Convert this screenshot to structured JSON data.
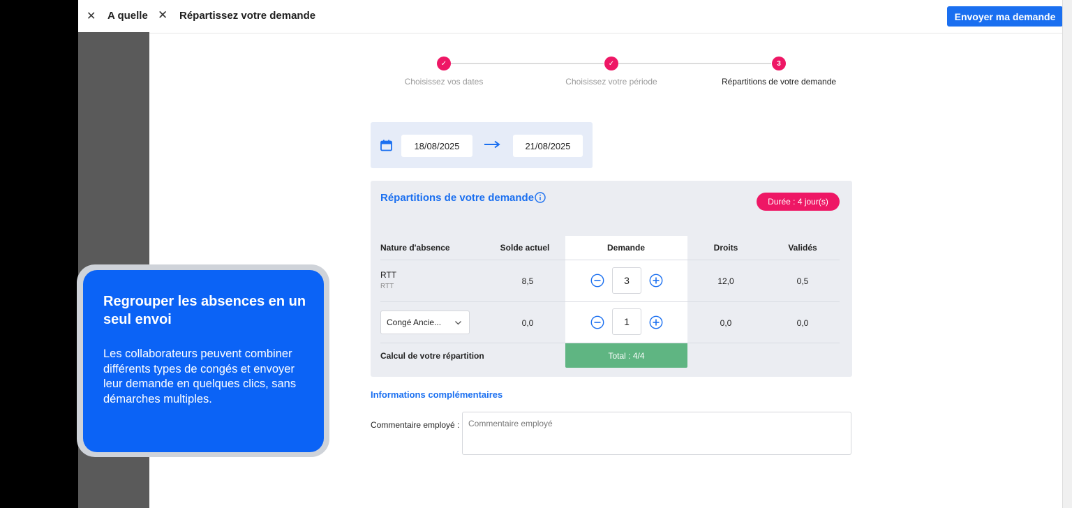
{
  "background_panel": {
    "close_icon": "close-icon",
    "title": "A quelle"
  },
  "header": {
    "title": "Répartissez votre demande",
    "send_label": "Envoyer ma demande"
  },
  "colors": {
    "primary": "#1a6ff0",
    "accent": "#ee1765",
    "success": "#5fb582",
    "callout": "#0b63f6"
  },
  "stepper": {
    "steps": [
      {
        "label": "Choisissez vos dates",
        "state": "done",
        "marker": "✓"
      },
      {
        "label": "Choisissez votre période",
        "state": "done",
        "marker": "✓"
      },
      {
        "label": "Répartitions de votre demande",
        "state": "active",
        "marker": "3"
      }
    ]
  },
  "dates": {
    "start": "18/08/2025",
    "end": "21/08/2025"
  },
  "repartition": {
    "title": "Répartitions de votre demande",
    "duration": "Durée : 4 jour(s)",
    "columns": [
      "Nature d'absence",
      "Solde actuel",
      "Demande",
      "Droits",
      "Validés"
    ],
    "rows": [
      {
        "nature": "RTT",
        "sub": "RTT",
        "solde": "8,5",
        "demande": "3",
        "droits": "12,0",
        "valides": "0,5"
      },
      {
        "nature": "Congé Ancie...",
        "solde": "0,0",
        "demande": "1",
        "droits": "0,0",
        "valides": "0,0"
      }
    ],
    "calc_label": "Calcul de votre répartition",
    "total": "Total : 4/4"
  },
  "info": {
    "title": "Informations complémentaires",
    "comment_label": "Commentaire employé :",
    "comment_placeholder": "Commentaire employé"
  },
  "callout": {
    "title": "Regrouper les absences en un seul envoi",
    "text": "Les collaborateurs peuvent combiner différents types de congés et envoyer leur demande en quelques clics, sans démarches multiples."
  }
}
